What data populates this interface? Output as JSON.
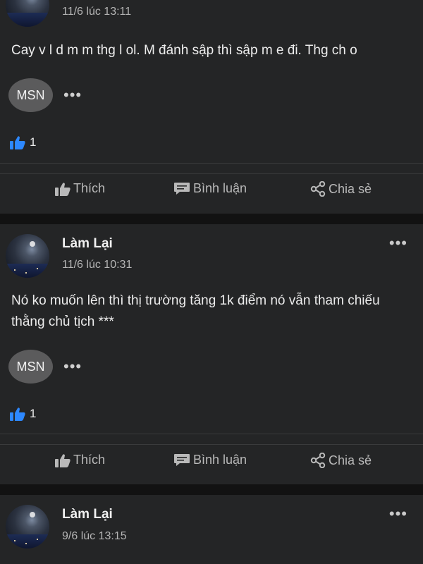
{
  "posts": [
    {
      "author": "",
      "time": "11/6 lúc 13:11",
      "content": "Cay v l d m m thg  l ol. M đánh sập thì sập m e đi. Thg ch o",
      "msn_label": "MSN",
      "like_count": "1"
    },
    {
      "author": "Làm Lại",
      "time": "11/6 lúc 10:31",
      "content": "Nó ko muốn lên thì thị trường tăng 1k điểm nó vẫn tham chiếu thằng chủ tịch ***",
      "msn_label": "MSN",
      "like_count": "1"
    },
    {
      "author": "Làm Lại",
      "time": "9/6 lúc 13:15",
      "content": "",
      "msn_label": "",
      "like_count": ""
    }
  ],
  "actions": {
    "like": "Thích",
    "comment": "Bình luận",
    "share": "Chia sẻ"
  },
  "icons": {
    "more": "more-dots-icon",
    "like": "thumbs-up-icon",
    "comment": "comment-icon",
    "share": "share-icon"
  },
  "colors": {
    "background": "#121212",
    "card": "#242526",
    "like_blue": "#2d88ff"
  }
}
